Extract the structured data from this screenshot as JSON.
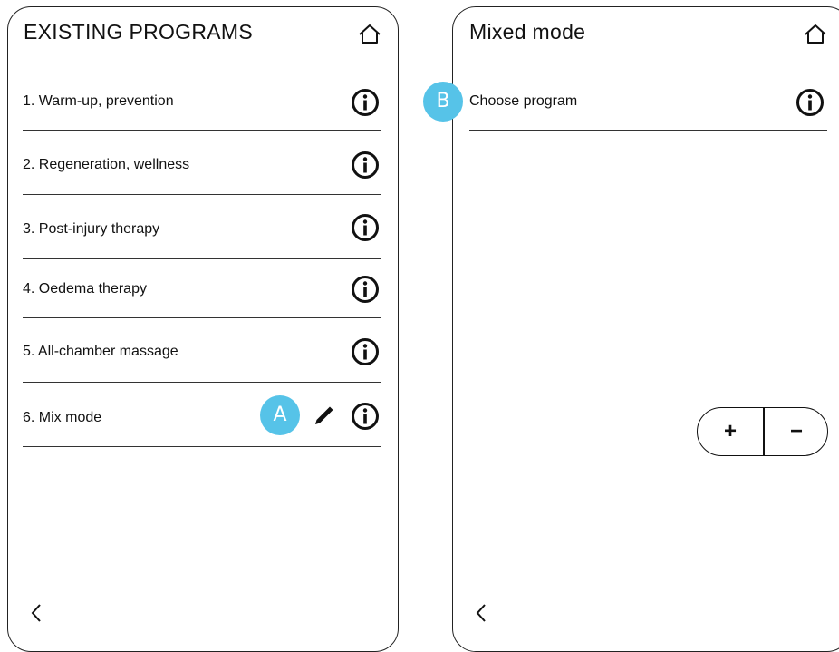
{
  "left_panel": {
    "title": "EXISTING PROGRAMS",
    "programs": [
      {
        "label": "1. Warm-up, prevention"
      },
      {
        "label": "2. Regeneration, wellness"
      },
      {
        "label": "3. Post-injury therapy"
      },
      {
        "label": "4. Oedema therapy"
      },
      {
        "label": "5. All-chamber massage"
      },
      {
        "label": "6. Mix mode"
      }
    ],
    "marker_label": "A",
    "home_icon": "home-icon",
    "back_icon": "chevron-left-icon",
    "edit_icon": "pencil-icon",
    "info_icon": "info-icon"
  },
  "right_panel": {
    "title": "Mixed mode",
    "choose_label": "Choose program",
    "marker_label": "B",
    "stepper": {
      "plus": "+",
      "minus": "−"
    },
    "home_icon": "home-icon",
    "back_icon": "chevron-left-icon"
  },
  "colors": {
    "marker": "#56c3e8",
    "line": "#333333"
  }
}
